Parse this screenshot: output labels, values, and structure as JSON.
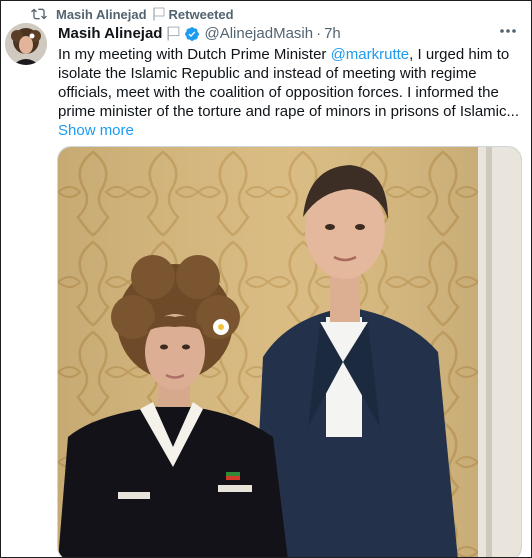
{
  "retweet_bar": {
    "icon": "retweet-icon",
    "name": "Masih Alinejad",
    "label": "Retweeted"
  },
  "tweet": {
    "author": {
      "name": "Masih Alinejad",
      "handle": "@AlinejadMasih",
      "verified": true,
      "avatar_icon": "avatar"
    },
    "separator": "·",
    "time": "7h",
    "more_icon": "more-horizontal-icon",
    "text_before_mention": "In my meeting with Dutch Prime Minister ",
    "mention": "@markrutte",
    "text_after_mention": ", I urged him to isolate the Islamic Republic and instead of meeting with regime officials, meet with the coalition of opposition forces.  I informed the prime minister of the torture and rape of minors in prisons of Islamic...",
    "show_more": "Show more"
  },
  "colors": {
    "text": "#0f1419",
    "secondary": "#536471",
    "link": "#1d9bf0",
    "verified": "#1d9bf0",
    "wallpaper": "#d6b67a",
    "suit": "#23324a"
  }
}
